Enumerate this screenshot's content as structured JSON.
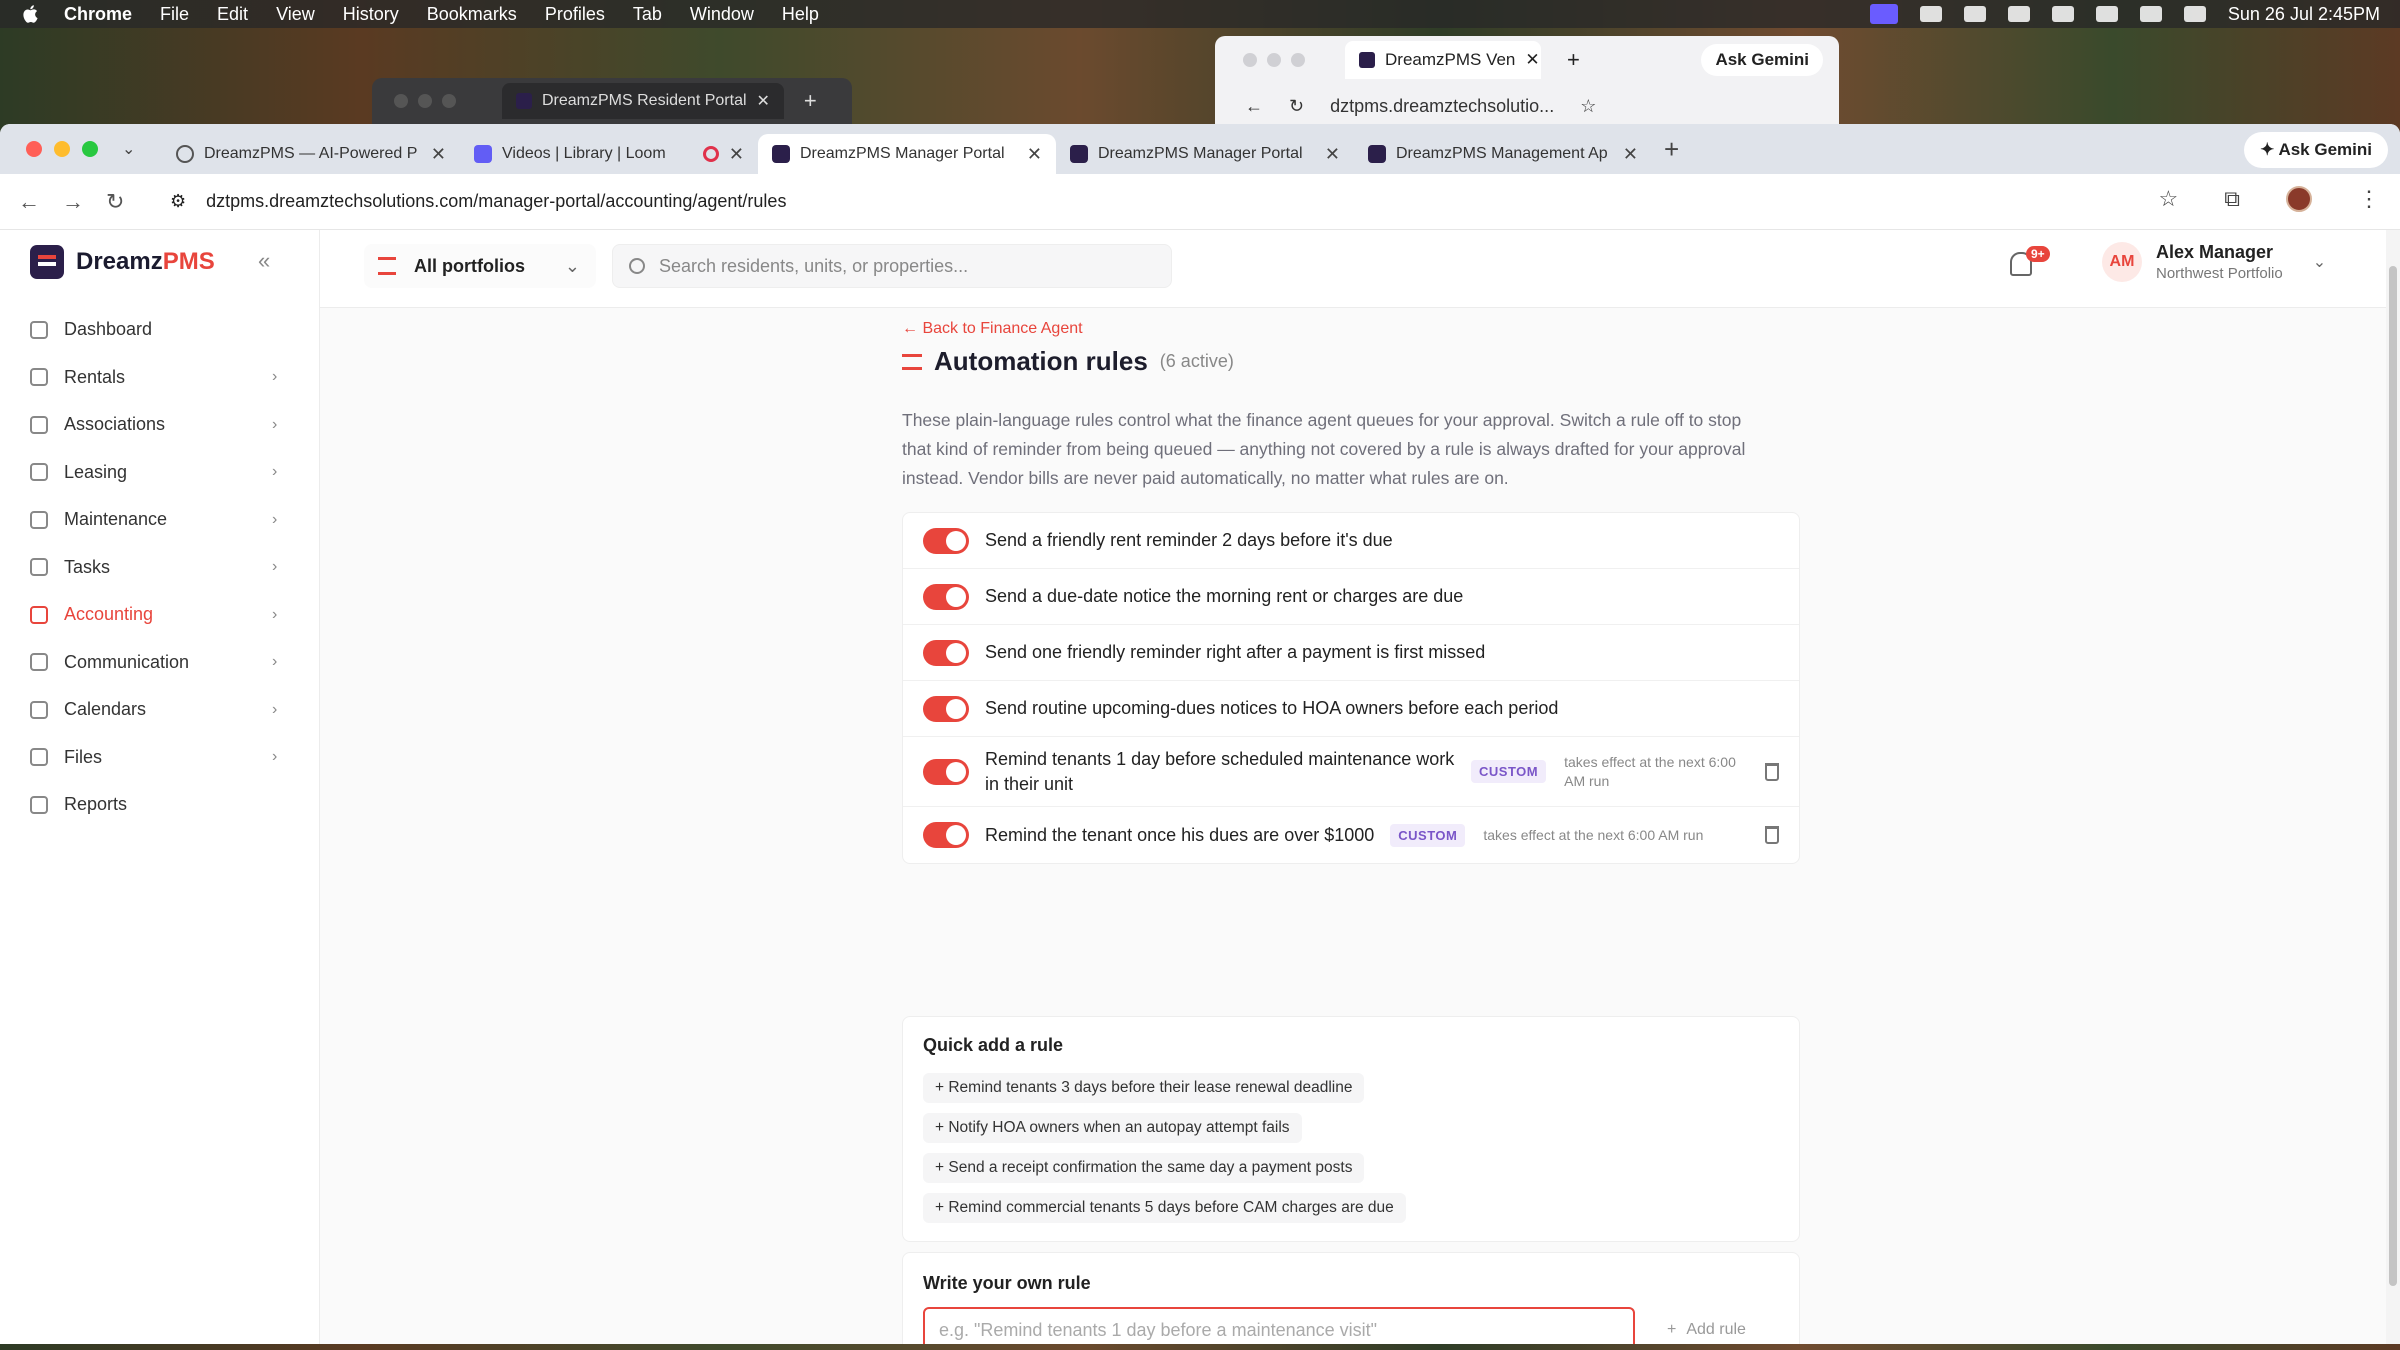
{
  "menubar": {
    "app": "Chrome",
    "items": [
      "File",
      "Edit",
      "View",
      "History",
      "Bookmarks",
      "Profiles",
      "Tab",
      "Window",
      "Help"
    ],
    "clock": "Sun 26 Jul  2:45PM"
  },
  "background_windows": {
    "resident_tab": "DreamzPMS Resident Portal",
    "vendor_tab": "DreamzPMS Ven",
    "vendor_ask": "Ask Gemini",
    "vendor_url": "dztpms.dreamztechsolutio..."
  },
  "browser": {
    "tabs": [
      {
        "title": "DreamzPMS — AI-Powered P",
        "icon": "globe-icon"
      },
      {
        "title": "Videos | Library | Loom",
        "icon": "loom-icon"
      },
      {
        "title": "DreamzPMS Manager Portal",
        "icon": "dreamz-icon",
        "active": true
      },
      {
        "title": "DreamzPMS Manager Portal",
        "icon": "dreamz-icon"
      },
      {
        "title": "DreamzPMS Management Ap",
        "icon": "dreamz-icon"
      }
    ],
    "ask_gemini": "Ask Gemini",
    "url": "dztpms.dreamztechsolutions.com/manager-portal/accounting/agent/rules"
  },
  "sidebar": {
    "brand_main": "Dreamz",
    "brand_accent": "PMS",
    "items": [
      {
        "label": "Dashboard",
        "chevron": false
      },
      {
        "label": "Rentals",
        "chevron": true
      },
      {
        "label": "Associations",
        "chevron": true
      },
      {
        "label": "Leasing",
        "chevron": true
      },
      {
        "label": "Maintenance",
        "chevron": true
      },
      {
        "label": "Tasks",
        "chevron": true
      },
      {
        "label": "Accounting",
        "chevron": true,
        "active": true
      },
      {
        "label": "Communication",
        "chevron": true
      },
      {
        "label": "Calendars",
        "chevron": true
      },
      {
        "label": "Files",
        "chevron": true
      },
      {
        "label": "Reports",
        "chevron": false
      }
    ]
  },
  "header": {
    "portfolio": "All portfolios",
    "search_placeholder": "Search residents, units, or properties...",
    "notification_badge": "9+",
    "user_initials": "AM",
    "user_name": "Alex Manager",
    "user_portfolio": "Northwest Portfolio"
  },
  "page": {
    "back_link": "Back to Finance Agent",
    "title": "Automation rules",
    "active_count": "(6 active)",
    "description": "These plain-language rules control what the finance agent queues for your approval. Switch a rule off to stop that kind of reminder from being queued — anything not covered by a rule is always drafted for your approval instead. Vendor bills are never paid automatically, no matter what rules are on.",
    "rules": [
      {
        "text": "Send a friendly rent reminder 2 days before it's due",
        "enabled": true
      },
      {
        "text": "Send a due-date notice the morning rent or charges are due",
        "enabled": true
      },
      {
        "text": "Send one friendly reminder right after a payment is first missed",
        "enabled": true
      },
      {
        "text": "Send routine upcoming-dues notices to HOA owners before each period",
        "enabled": true
      },
      {
        "text": "Remind tenants 1 day before scheduled maintenance work in their unit",
        "enabled": true,
        "badge": "CUSTOM",
        "effect": "takes effect at the next 6:00 AM run"
      },
      {
        "text": "Remind the tenant once his dues are over $1000",
        "enabled": true,
        "badge": "CUSTOM",
        "effect": "takes effect at the next 6:00 AM run"
      }
    ],
    "quick_add_title": "Quick add a rule",
    "quick_add": [
      "Remind tenants 3 days before their lease renewal deadline",
      "Notify HOA owners when an autopay attempt fails",
      "Send a receipt confirmation the same day a payment posts",
      "Remind commercial tenants 5 days before CAM charges are due"
    ],
    "write_title": "Write your own rule",
    "write_placeholder": "e.g. \"Remind tenants 1 day before a maintenance visit\"",
    "add_rule_label": "Add rule"
  },
  "colors": {
    "accent": "#e8453c",
    "custom_badge": "#7a56c8"
  }
}
